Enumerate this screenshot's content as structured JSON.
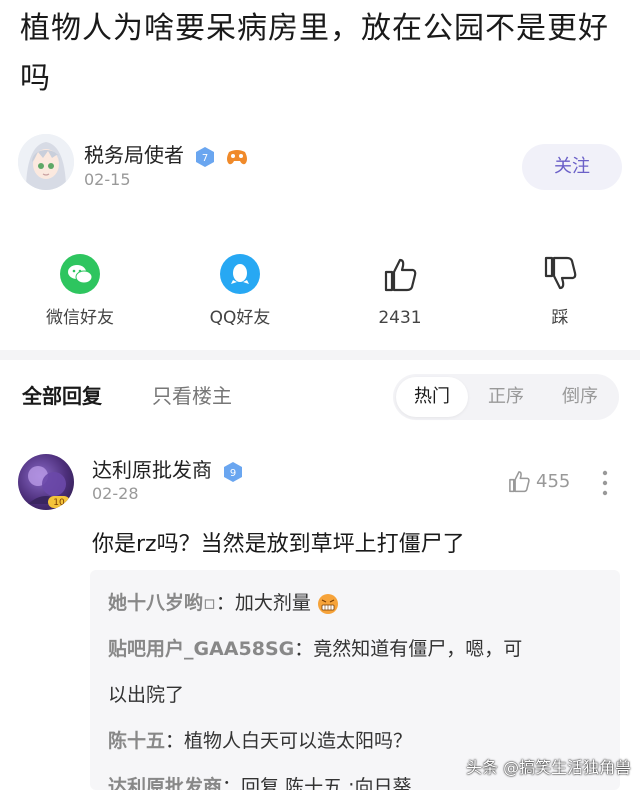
{
  "post": {
    "title": "植物人为啥要呆病房里，放在公园不是更好吗"
  },
  "author": {
    "name": "税务局使者",
    "level": "7",
    "date": "02-15",
    "follow_label": "关注"
  },
  "actions": [
    {
      "label": "微信好友",
      "icon": "wechat-icon"
    },
    {
      "label": "QQ好友",
      "icon": "qq-icon"
    },
    {
      "label": "2431",
      "icon": "thumbs-up-icon"
    },
    {
      "label": "踩",
      "icon": "thumbs-down-icon"
    }
  ],
  "reply_tabs": {
    "all": "全部回复",
    "owner_only": "只看楼主",
    "sort": [
      "热门",
      "正序",
      "倒序"
    ],
    "sort_active": "热门"
  },
  "comment": {
    "name": "达利原批发商",
    "level": "9",
    "avatar_level": "10",
    "date": "02-28",
    "likes": "455",
    "text": "你是rz吗？当然是放到草坪上打僵尸了",
    "replies": [
      {
        "user": "她十八岁哟▫",
        "text": "加大剂量"
      },
      {
        "user": "贴吧用户_GAA58SG",
        "text": "竟然知道有僵尸，嗯，可"
      },
      {
        "user": "",
        "text": "以出院了"
      },
      {
        "user": "陈十五",
        "text": "植物人白天可以造太阳吗？"
      },
      {
        "user": "达利原批发商",
        "text": "回复 陈十五 :向日葵"
      }
    ]
  },
  "watermark": "头条 @搞笑生活独角兽",
  "colors": {
    "accent": "#6b60c8",
    "wechat": "#2ec55f",
    "qq": "#27a8f3",
    "badge_blue": "#6aa6f0",
    "badge_orange": "#f08a2a"
  }
}
